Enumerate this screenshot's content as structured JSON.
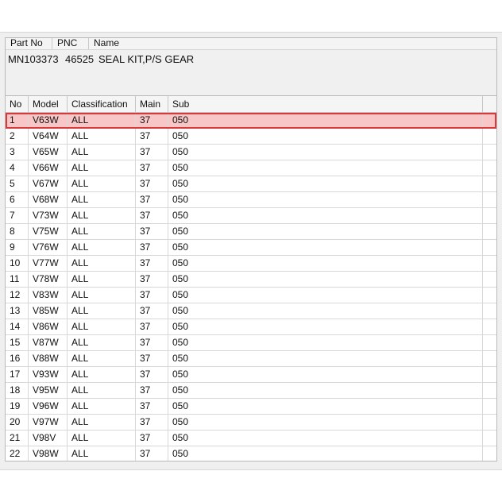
{
  "parts": {
    "headers": [
      "Part No",
      "PNC",
      "Name"
    ],
    "row": {
      "part_no": "MN103373",
      "pnc": "46525",
      "name": "SEAL KIT,P/S GEAR"
    }
  },
  "grid": {
    "headers": [
      "No",
      "Model",
      "Classification",
      "Main",
      "Sub"
    ],
    "selected_index": 0,
    "selected_color": "#f8c6c6",
    "rows": [
      {
        "no": "1",
        "model": "V63W",
        "classification": "ALL",
        "main": "37",
        "sub": "050"
      },
      {
        "no": "2",
        "model": "V64W",
        "classification": "ALL",
        "main": "37",
        "sub": "050"
      },
      {
        "no": "3",
        "model": "V65W",
        "classification": "ALL",
        "main": "37",
        "sub": "050"
      },
      {
        "no": "4",
        "model": "V66W",
        "classification": "ALL",
        "main": "37",
        "sub": "050"
      },
      {
        "no": "5",
        "model": "V67W",
        "classification": "ALL",
        "main": "37",
        "sub": "050"
      },
      {
        "no": "6",
        "model": "V68W",
        "classification": "ALL",
        "main": "37",
        "sub": "050"
      },
      {
        "no": "7",
        "model": "V73W",
        "classification": "ALL",
        "main": "37",
        "sub": "050"
      },
      {
        "no": "8",
        "model": "V75W",
        "classification": "ALL",
        "main": "37",
        "sub": "050"
      },
      {
        "no": "9",
        "model": "V76W",
        "classification": "ALL",
        "main": "37",
        "sub": "050"
      },
      {
        "no": "10",
        "model": "V77W",
        "classification": "ALL",
        "main": "37",
        "sub": "050"
      },
      {
        "no": "11",
        "model": "V78W",
        "classification": "ALL",
        "main": "37",
        "sub": "050"
      },
      {
        "no": "12",
        "model": "V83W",
        "classification": "ALL",
        "main": "37",
        "sub": "050"
      },
      {
        "no": "13",
        "model": "V85W",
        "classification": "ALL",
        "main": "37",
        "sub": "050"
      },
      {
        "no": "14",
        "model": "V86W",
        "classification": "ALL",
        "main": "37",
        "sub": "050"
      },
      {
        "no": "15",
        "model": "V87W",
        "classification": "ALL",
        "main": "37",
        "sub": "050"
      },
      {
        "no": "16",
        "model": "V88W",
        "classification": "ALL",
        "main": "37",
        "sub": "050"
      },
      {
        "no": "17",
        "model": "V93W",
        "classification": "ALL",
        "main": "37",
        "sub": "050"
      },
      {
        "no": "18",
        "model": "V95W",
        "classification": "ALL",
        "main": "37",
        "sub": "050"
      },
      {
        "no": "19",
        "model": "V96W",
        "classification": "ALL",
        "main": "37",
        "sub": "050"
      },
      {
        "no": "20",
        "model": "V97W",
        "classification": "ALL",
        "main": "37",
        "sub": "050"
      },
      {
        "no": "21",
        "model": "V98V",
        "classification": "ALL",
        "main": "37",
        "sub": "050"
      },
      {
        "no": "22",
        "model": "V98W",
        "classification": "ALL",
        "main": "37",
        "sub": "050"
      }
    ]
  }
}
